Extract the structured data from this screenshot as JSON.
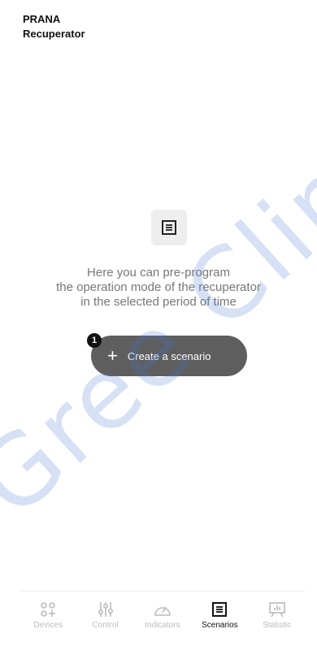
{
  "header": {
    "line1": "PRANA",
    "line2": "Recuperator"
  },
  "empty_state": {
    "icon": "list-document-icon",
    "lines": [
      "Here you can pre-program",
      "the operation mode of the recuperator",
      "in the selected period of time"
    ]
  },
  "create_button": {
    "label": "Create a scenario",
    "icon": "plus-icon",
    "badge": "1"
  },
  "watermark": "Gree Clima",
  "bottom_nav": {
    "active": "Scenarios",
    "items": [
      {
        "label": "Devices",
        "icon": "devices-icon"
      },
      {
        "label": "Control",
        "icon": "sliders-icon"
      },
      {
        "label": "Indicators",
        "icon": "gauge-icon"
      },
      {
        "label": "Scenarios",
        "icon": "list-document-icon"
      },
      {
        "label": "Statistic",
        "icon": "chart-board-icon"
      }
    ]
  },
  "colors": {
    "button_bg": "#5e5e5e",
    "watermark": "#4678d2",
    "inactive_nav": "#bbbbbb"
  }
}
